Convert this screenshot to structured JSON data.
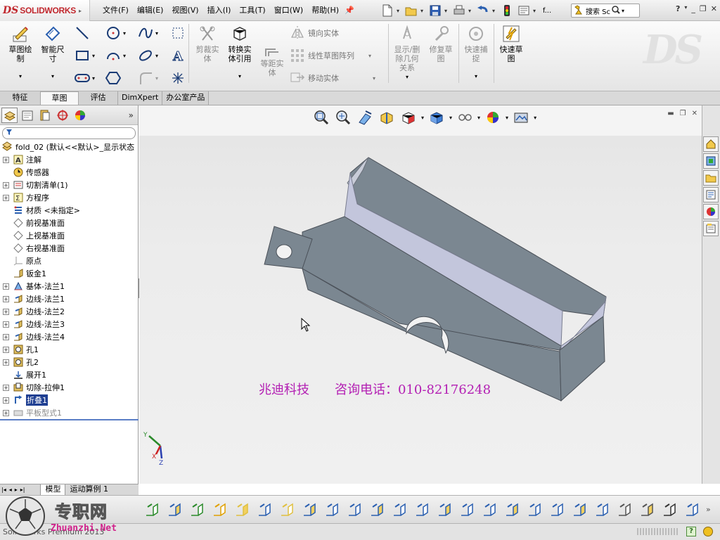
{
  "app": {
    "logo_ds": "DS",
    "logo_text": "SOLIDWORKS",
    "menus": [
      "文件(F)",
      "编辑(E)",
      "视图(V)",
      "插入(I)",
      "工具(T)",
      "窗口(W)",
      "帮助(H)"
    ],
    "doc_short": "f...",
    "search_label": "搜索 Sc",
    "help_label": "?"
  },
  "ribbon": {
    "sketch_label": "草图绘\n制",
    "smart_dim_label": "智能尺\n寸",
    "trim_label": "剪裁实\n体",
    "convert_label": "转换实\n体引用",
    "offset_label": "等距实\n体",
    "mirror_label": "镜向实体",
    "linear_pattern_label": "线性草图阵列",
    "move_label": "移动实体",
    "show_relations_label": "显示/删\n除几何\n关系",
    "repair_label": "修复草\n图",
    "quick_snaps_label": "快速捕\n捉",
    "rapid_sketch_label": "快速草\n图"
  },
  "command_tabs": [
    "特征",
    "草图",
    "评估",
    "DimXpert",
    "办公室产品"
  ],
  "active_command_tab": "草图",
  "feature_tree": {
    "root": "fold_02  (默认<<默认>_显示状态",
    "items": [
      {
        "label": "注解",
        "icon": "annotation-icon",
        "expand": true
      },
      {
        "label": "传感器",
        "icon": "sensor-icon",
        "expand": false
      },
      {
        "label": "切割清单(1)",
        "icon": "cut-list-icon",
        "expand": true
      },
      {
        "label": "方程序",
        "icon": "equation-icon",
        "expand": true
      },
      {
        "label": "材质 <未指定>",
        "icon": "material-icon",
        "expand": false
      },
      {
        "label": "前视基准面",
        "icon": "plane-icon",
        "expand": false
      },
      {
        "label": "上视基准面",
        "icon": "plane-icon",
        "expand": false
      },
      {
        "label": "右视基准面",
        "icon": "plane-icon",
        "expand": false
      },
      {
        "label": "原点",
        "icon": "origin-icon",
        "expand": false
      },
      {
        "label": "钣金1",
        "icon": "sheet-metal-icon",
        "expand": false
      },
      {
        "label": "基体-法兰1",
        "icon": "base-flange-icon",
        "expand": true
      },
      {
        "label": "边线-法兰1",
        "icon": "edge-flange-icon",
        "expand": true
      },
      {
        "label": "边线-法兰2",
        "icon": "edge-flange-icon",
        "expand": true
      },
      {
        "label": "边线-法兰3",
        "icon": "edge-flange-icon",
        "expand": true
      },
      {
        "label": "边线-法兰4",
        "icon": "edge-flange-icon",
        "expand": true
      },
      {
        "label": "孔1",
        "icon": "hole-icon",
        "expand": true
      },
      {
        "label": "孔2",
        "icon": "hole-icon",
        "expand": true
      },
      {
        "label": "展开1",
        "icon": "unfold-icon",
        "expand": false
      },
      {
        "label": "切除-拉伸1",
        "icon": "cut-extrude-icon",
        "expand": true
      },
      {
        "label": "折叠1",
        "icon": "fold-icon",
        "expand": true,
        "selected": true
      },
      {
        "label": "平板型式1",
        "icon": "flat-pattern-icon",
        "expand": true,
        "grey": true
      }
    ]
  },
  "bottom_tabs": [
    "模型",
    "运动算例 1"
  ],
  "viewport": {
    "overlay_company": "兆迪科技",
    "overlay_phone": "咨询电话：010-82176248",
    "axis_labels": {
      "x": "X",
      "y": "Y",
      "z": "Z"
    }
  },
  "status_bar": {
    "left": "SolidWorks Premium 2013",
    "help": "?"
  },
  "site_watermark": {
    "name": "专职网",
    "url": "Zhuanzhi.Net"
  },
  "colors": {
    "brand_red": "#c1272d",
    "overlay_magenta": "#b31fb3",
    "selection_blue": "#1f3f92",
    "part_face": "#7b8791"
  }
}
